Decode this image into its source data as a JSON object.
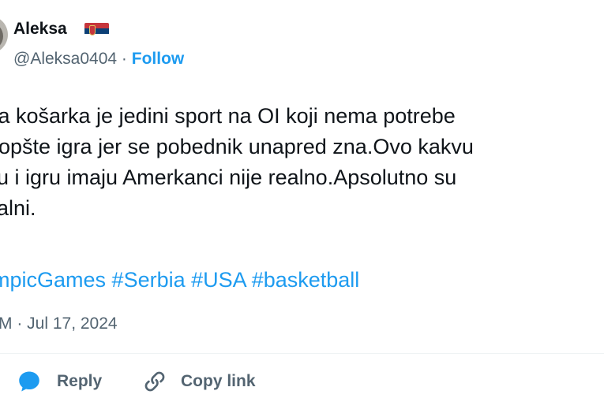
{
  "tweet": {
    "author_name": "Aleksa",
    "handle": "@Aleksa0404",
    "separator": " · ",
    "follow_label": "Follow",
    "text_lines": [
      "ka košarka je jedini sport na OI koji nema potrebe",
      "opšte igra jer se pobednik unapred zna.Ovo kakvu",
      "u i igru imaju Amerkanci nije realno.Apsolutno su",
      "alni."
    ],
    "hashtags": [
      "mpicGames",
      "#Serbia",
      "#USA",
      "#basketball"
    ],
    "timestamp": "M · Jul 17, 2024"
  },
  "actions": {
    "reply_label": "Reply",
    "copy_link_label": "Copy link"
  },
  "icons": {
    "flag": "serbia-flag-icon",
    "reply": "reply-bubble-icon",
    "copy": "link-icon"
  },
  "colors": {
    "accent": "#1d9bf0",
    "secondary_text": "#536471",
    "primary_text": "#0f1419",
    "flag_red": "#c6363c",
    "flag_blue": "#0c4076",
    "flag_white": "#ffffff"
  }
}
